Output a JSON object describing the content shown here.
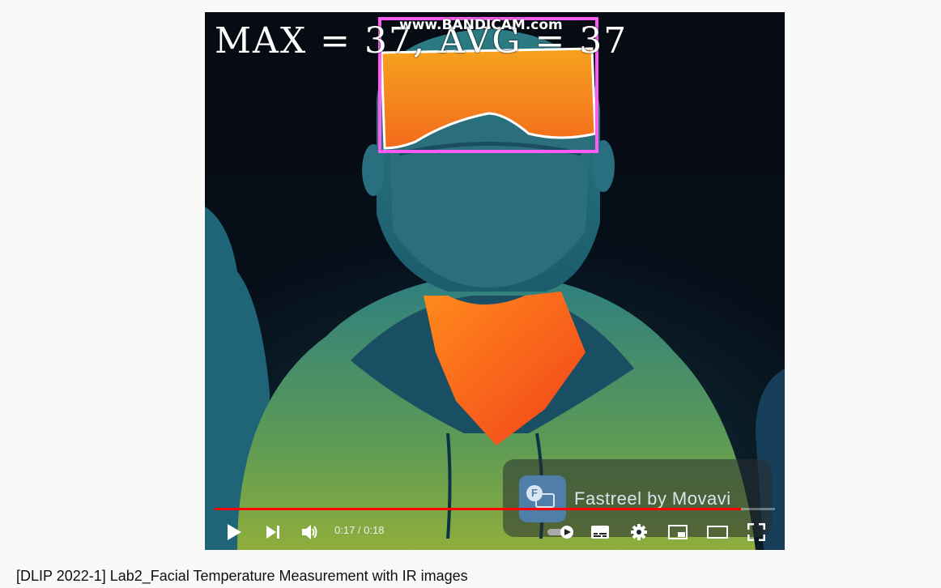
{
  "video": {
    "overlay_text": "MAX = 37, AVG = 37",
    "watermark": "www.BANDICAM.com",
    "branding": "Fastreel by Movavi",
    "branding_logo_letter": "F",
    "progress_fraction": 0.94
  },
  "controls": {
    "time_display": "0:17 / 0:18",
    "icons": [
      "play-icon",
      "next-icon",
      "volume-icon",
      "autoplay-toggle-icon",
      "subtitles-icon",
      "settings-icon",
      "miniplayer-icon",
      "theater-mode-icon",
      "fullscreen-icon"
    ]
  },
  "page": {
    "title": "[DLIP 2022-1] Lab2_Facial Temperature Measurement with IR images"
  },
  "colors": {
    "progress": "#ff0000",
    "face_box": "#ff5cf4"
  }
}
